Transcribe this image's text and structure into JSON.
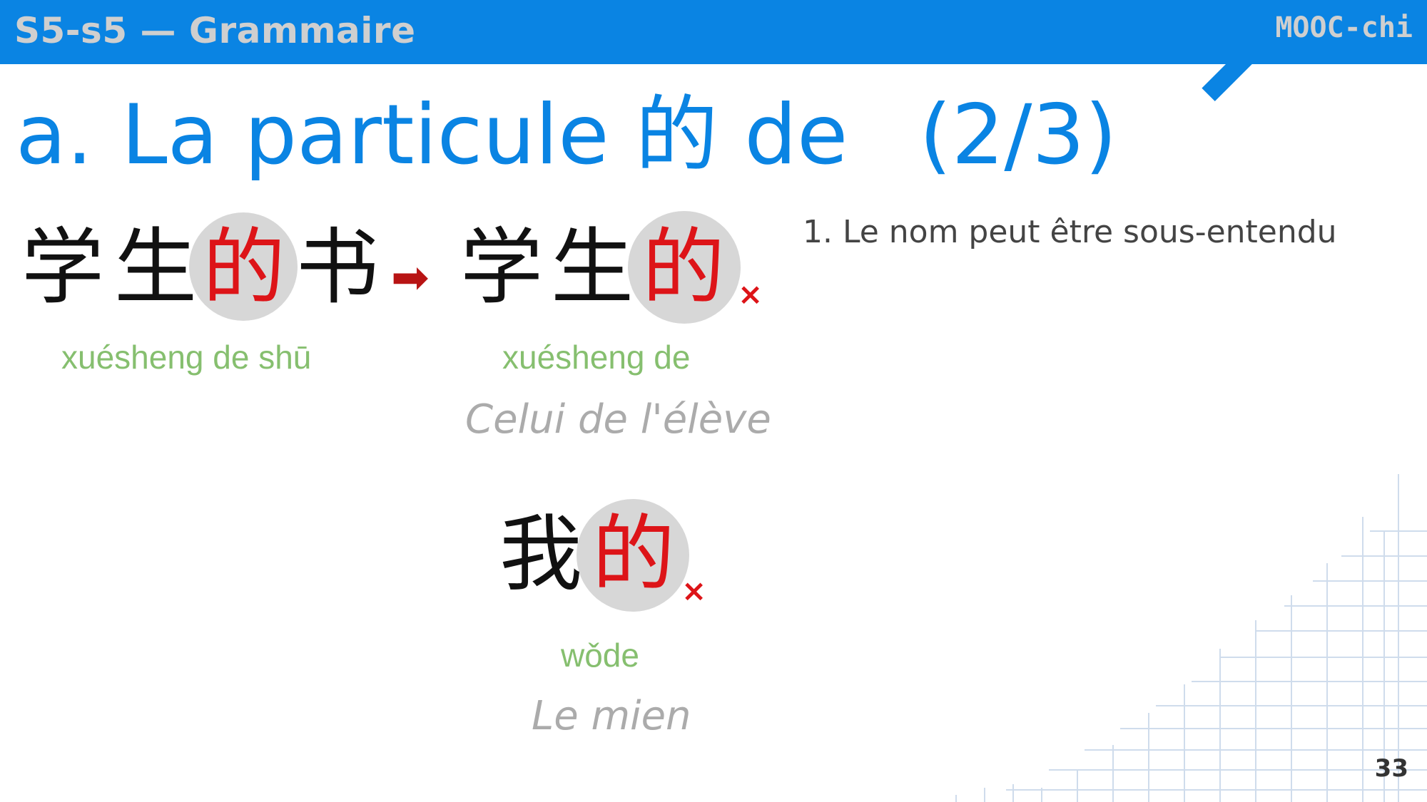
{
  "header": {
    "title": "S5-s5 — Grammaire",
    "brand": "MOOC-chi",
    "accent_color": "#0a84e3"
  },
  "slide": {
    "title_prefix": "a.",
    "title_main": "La particule 的 de",
    "title_part": "(2/3)",
    "note": "1. Le nom peut être sous-entendu",
    "page_number": "33"
  },
  "examples": {
    "full": {
      "chars": [
        "学",
        "生",
        "的",
        "书"
      ],
      "pinyin": "xuésheng de shū"
    },
    "arrow_icon": "right-arrow-icon",
    "short": {
      "chars": [
        "学",
        "生",
        "的"
      ],
      "omitted_mark": "×",
      "pinyin": "xuésheng de",
      "gloss": "Celui de l'élève"
    },
    "mine": {
      "chars": [
        "我",
        "的"
      ],
      "omitted_mark": "×",
      "pinyin": "wǒde",
      "gloss": "Le mien"
    }
  },
  "colors": {
    "particle": "#dd1418",
    "pinyin": "#86bf6f",
    "gloss": "#ababab",
    "highlight_circle": "#d7d7d7"
  }
}
